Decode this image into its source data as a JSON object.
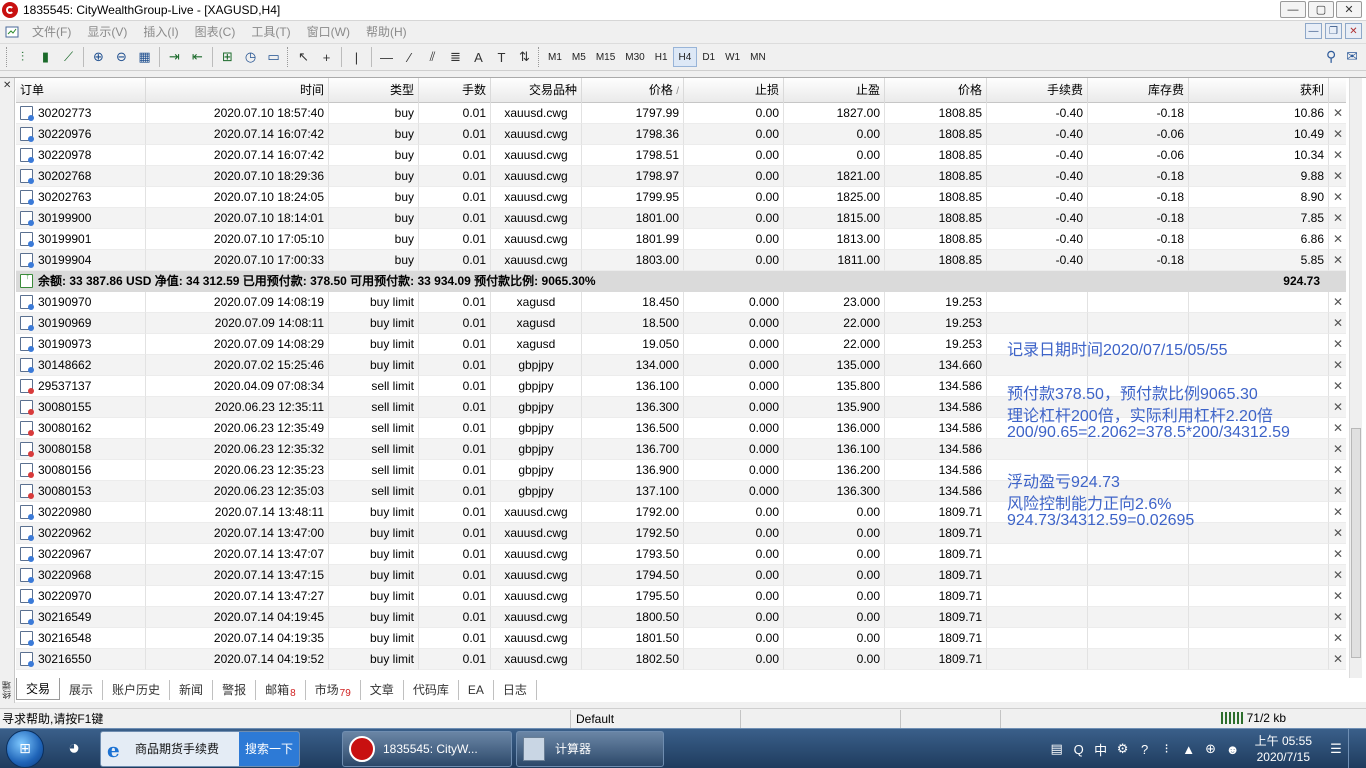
{
  "window": {
    "title": "1835545: CityWealthGroup-Live - [XAGUSD,H4]",
    "controls": [
      "—",
      "▢",
      "✕"
    ]
  },
  "menu": {
    "items": [
      "文件(F)",
      "显示(V)",
      "插入(I)",
      "图表(C)",
      "工具(T)",
      "窗口(W)",
      "帮助(H)"
    ]
  },
  "toolbar": {
    "timeframes": [
      "M1",
      "M5",
      "M15",
      "M30",
      "H1",
      "H4",
      "D1",
      "W1",
      "MN"
    ],
    "active_timeframe": "H4"
  },
  "table": {
    "headers": [
      "订单",
      "时间",
      "类型",
      "手数",
      "交易品种",
      "价格",
      "止损",
      "止盈",
      "价格",
      "手续费",
      "库存费",
      "获利"
    ],
    "sort_indicator": "/",
    "open_rows": [
      {
        "order": "30202773",
        "time": "2020.07.10 18:57:40",
        "type": "buy",
        "lots": "0.01",
        "symbol": "xauusd.cwg",
        "price": "1797.99",
        "sl": "0.00",
        "tp": "1827.00",
        "cur": "1808.85",
        "commission": "-0.40",
        "swap": "-0.18",
        "profit": "10.86"
      },
      {
        "order": "30220976",
        "time": "2020.07.14 16:07:42",
        "type": "buy",
        "lots": "0.01",
        "symbol": "xauusd.cwg",
        "price": "1798.36",
        "sl": "0.00",
        "tp": "0.00",
        "cur": "1808.85",
        "commission": "-0.40",
        "swap": "-0.06",
        "profit": "10.49"
      },
      {
        "order": "30220978",
        "time": "2020.07.14 16:07:42",
        "type": "buy",
        "lots": "0.01",
        "symbol": "xauusd.cwg",
        "price": "1798.51",
        "sl": "0.00",
        "tp": "0.00",
        "cur": "1808.85",
        "commission": "-0.40",
        "swap": "-0.06",
        "profit": "10.34"
      },
      {
        "order": "30202768",
        "time": "2020.07.10 18:29:36",
        "type": "buy",
        "lots": "0.01",
        "symbol": "xauusd.cwg",
        "price": "1798.97",
        "sl": "0.00",
        "tp": "1821.00",
        "cur": "1808.85",
        "commission": "-0.40",
        "swap": "-0.18",
        "profit": "9.88"
      },
      {
        "order": "30202763",
        "time": "2020.07.10 18:24:05",
        "type": "buy",
        "lots": "0.01",
        "symbol": "xauusd.cwg",
        "price": "1799.95",
        "sl": "0.00",
        "tp": "1825.00",
        "cur": "1808.85",
        "commission": "-0.40",
        "swap": "-0.18",
        "profit": "8.90"
      },
      {
        "order": "30199900",
        "time": "2020.07.10 18:14:01",
        "type": "buy",
        "lots": "0.01",
        "symbol": "xauusd.cwg",
        "price": "1801.00",
        "sl": "0.00",
        "tp": "1815.00",
        "cur": "1808.85",
        "commission": "-0.40",
        "swap": "-0.18",
        "profit": "7.85"
      },
      {
        "order": "30199901",
        "time": "2020.07.10 17:05:10",
        "type": "buy",
        "lots": "0.01",
        "symbol": "xauusd.cwg",
        "price": "1801.99",
        "sl": "0.00",
        "tp": "1813.00",
        "cur": "1808.85",
        "commission": "-0.40",
        "swap": "-0.18",
        "profit": "6.86"
      },
      {
        "order": "30199904",
        "time": "2020.07.10 17:00:33",
        "type": "buy",
        "lots": "0.01",
        "symbol": "xauusd.cwg",
        "price": "1803.00",
        "sl": "0.00",
        "tp": "1811.00",
        "cur": "1808.85",
        "commission": "-0.40",
        "swap": "-0.18",
        "profit": "5.85"
      }
    ],
    "summary": {
      "text": "余额: 33 387.86 USD  净值: 34 312.59  已用预付款: 378.50  可用预付款: 33 934.09  预付款比例: 9065.30%",
      "profit": "924.73"
    },
    "pending_rows": [
      {
        "order": "30190970",
        "time": "2020.07.09 14:08:19",
        "type": "buy limit",
        "lots": "0.01",
        "symbol": "xagusd",
        "price": "18.450",
        "sl": "0.000",
        "tp": "23.000",
        "cur": "19.253",
        "side": "buy"
      },
      {
        "order": "30190969",
        "time": "2020.07.09 14:08:11",
        "type": "buy limit",
        "lots": "0.01",
        "symbol": "xagusd",
        "price": "18.500",
        "sl": "0.000",
        "tp": "22.000",
        "cur": "19.253",
        "side": "buy"
      },
      {
        "order": "30190973",
        "time": "2020.07.09 14:08:29",
        "type": "buy limit",
        "lots": "0.01",
        "symbol": "xagusd",
        "price": "19.050",
        "sl": "0.000",
        "tp": "22.000",
        "cur": "19.253",
        "side": "buy"
      },
      {
        "order": "30148662",
        "time": "2020.07.02 15:25:46",
        "type": "buy limit",
        "lots": "0.01",
        "symbol": "gbpjpy",
        "price": "134.000",
        "sl": "0.000",
        "tp": "135.000",
        "cur": "134.660",
        "side": "buy"
      },
      {
        "order": "29537137",
        "time": "2020.04.09 07:08:34",
        "type": "sell limit",
        "lots": "0.01",
        "symbol": "gbpjpy",
        "price": "136.100",
        "sl": "0.000",
        "tp": "135.800",
        "cur": "134.586",
        "side": "sell"
      },
      {
        "order": "30080155",
        "time": "2020.06.23 12:35:11",
        "type": "sell limit",
        "lots": "0.01",
        "symbol": "gbpjpy",
        "price": "136.300",
        "sl": "0.000",
        "tp": "135.900",
        "cur": "134.586",
        "side": "sell"
      },
      {
        "order": "30080162",
        "time": "2020.06.23 12:35:49",
        "type": "sell limit",
        "lots": "0.01",
        "symbol": "gbpjpy",
        "price": "136.500",
        "sl": "0.000",
        "tp": "136.000",
        "cur": "134.586",
        "side": "sell"
      },
      {
        "order": "30080158",
        "time": "2020.06.23 12:35:32",
        "type": "sell limit",
        "lots": "0.01",
        "symbol": "gbpjpy",
        "price": "136.700",
        "sl": "0.000",
        "tp": "136.100",
        "cur": "134.586",
        "side": "sell"
      },
      {
        "order": "30080156",
        "time": "2020.06.23 12:35:23",
        "type": "sell limit",
        "lots": "0.01",
        "symbol": "gbpjpy",
        "price": "136.900",
        "sl": "0.000",
        "tp": "136.200",
        "cur": "134.586",
        "side": "sell"
      },
      {
        "order": "30080153",
        "time": "2020.06.23 12:35:03",
        "type": "sell limit",
        "lots": "0.01",
        "symbol": "gbpjpy",
        "price": "137.100",
        "sl": "0.000",
        "tp": "136.300",
        "cur": "134.586",
        "side": "sell"
      },
      {
        "order": "30220980",
        "time": "2020.07.14 13:48:11",
        "type": "buy limit",
        "lots": "0.01",
        "symbol": "xauusd.cwg",
        "price": "1792.00",
        "sl": "0.00",
        "tp": "0.00",
        "cur": "1809.71",
        "side": "buy"
      },
      {
        "order": "30220962",
        "time": "2020.07.14 13:47:00",
        "type": "buy limit",
        "lots": "0.01",
        "symbol": "xauusd.cwg",
        "price": "1792.50",
        "sl": "0.00",
        "tp": "0.00",
        "cur": "1809.71",
        "side": "buy"
      },
      {
        "order": "30220967",
        "time": "2020.07.14 13:47:07",
        "type": "buy limit",
        "lots": "0.01",
        "symbol": "xauusd.cwg",
        "price": "1793.50",
        "sl": "0.00",
        "tp": "0.00",
        "cur": "1809.71",
        "side": "buy"
      },
      {
        "order": "30220968",
        "time": "2020.07.14 13:47:15",
        "type": "buy limit",
        "lots": "0.01",
        "symbol": "xauusd.cwg",
        "price": "1794.50",
        "sl": "0.00",
        "tp": "0.00",
        "cur": "1809.71",
        "side": "buy"
      },
      {
        "order": "30220970",
        "time": "2020.07.14 13:47:27",
        "type": "buy limit",
        "lots": "0.01",
        "symbol": "xauusd.cwg",
        "price": "1795.50",
        "sl": "0.00",
        "tp": "0.00",
        "cur": "1809.71",
        "side": "buy"
      },
      {
        "order": "30216549",
        "time": "2020.07.14 04:19:45",
        "type": "buy limit",
        "lots": "0.01",
        "symbol": "xauusd.cwg",
        "price": "1800.50",
        "sl": "0.00",
        "tp": "0.00",
        "cur": "1809.71",
        "side": "buy"
      },
      {
        "order": "30216548",
        "time": "2020.07.14 04:19:35",
        "type": "buy limit",
        "lots": "0.01",
        "symbol": "xauusd.cwg",
        "price": "1801.50",
        "sl": "0.00",
        "tp": "0.00",
        "cur": "1809.71",
        "side": "buy"
      },
      {
        "order": "30216550",
        "time": "2020.07.14 04:19:52",
        "type": "buy limit",
        "lots": "0.01",
        "symbol": "xauusd.cwg",
        "price": "1802.50",
        "sl": "0.00",
        "tp": "0.00",
        "cur": "1809.71",
        "side": "buy"
      }
    ],
    "close_glyph": "✕"
  },
  "annotations": [
    "记录日期时间2020/07/15/05/55",
    "预付款378.50，预付款比例9065.30",
    "理论杠杆200倍，实际利用杠杆2.20倍",
    "200/90.65=2.2062=378.5*200/34312.59",
    "浮动盈亏924.73",
    "风险控制能力正向2.6%",
    "924.73/34312.59=0.02695"
  ],
  "side_panel": {
    "label": "终端"
  },
  "tabs": [
    {
      "label": "交易",
      "badge": ""
    },
    {
      "label": "展示",
      "badge": ""
    },
    {
      "label": "账户历史",
      "badge": ""
    },
    {
      "label": "新闻",
      "badge": ""
    },
    {
      "label": "警报",
      "badge": ""
    },
    {
      "label": "邮箱",
      "badge": "8"
    },
    {
      "label": "市场",
      "badge": "79"
    },
    {
      "label": "文章",
      "badge": ""
    },
    {
      "label": "代码库",
      "badge": ""
    },
    {
      "label": "EA",
      "badge": ""
    },
    {
      "label": "日志",
      "badge": ""
    }
  ],
  "statusbar": {
    "help": "寻求帮助,请按F1键",
    "profile": "Default",
    "traffic": "71/2 kb"
  },
  "taskbar": {
    "ie_label": "商品期货手续费",
    "ie_search": "搜索一下",
    "mt4_label": "1835545: CityW...",
    "calc_label": "计算器",
    "ime": "中",
    "clock_time": "上午 05:55",
    "clock_date": "2020/7/15"
  }
}
